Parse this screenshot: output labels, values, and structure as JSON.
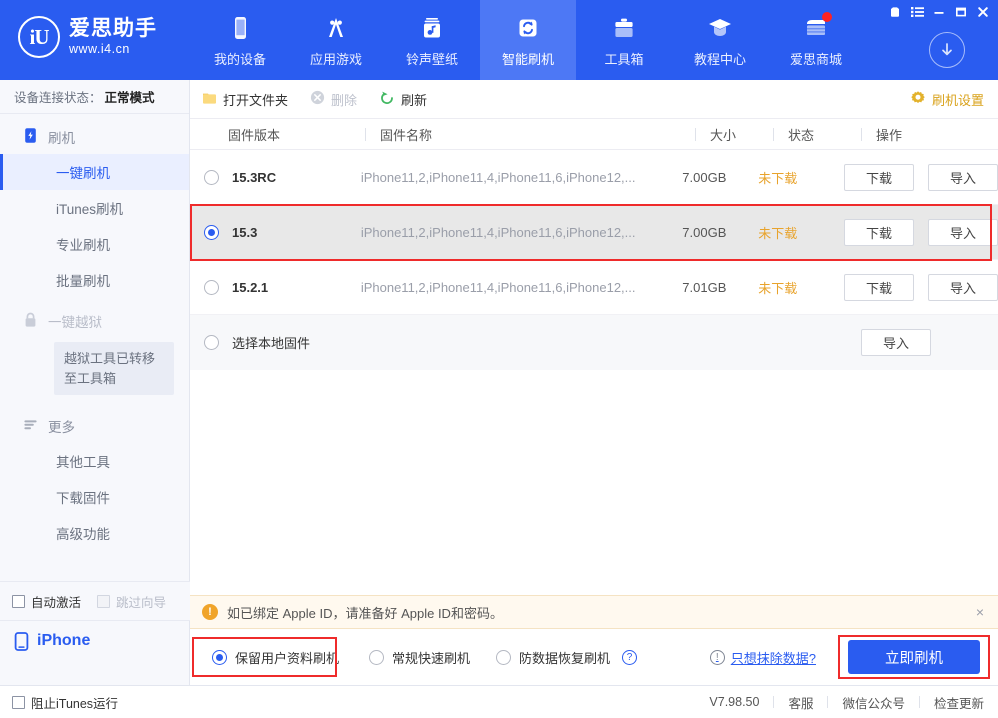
{
  "brand": {
    "name": "爱思助手",
    "url": "www.i4.cn",
    "logo_text": "iU"
  },
  "topnav": {
    "items": [
      {
        "label": "我的设备",
        "icon": "phone-icon",
        "active": false
      },
      {
        "label": "应用游戏",
        "icon": "appstore-icon",
        "active": false
      },
      {
        "label": "铃声壁纸",
        "icon": "music-icon",
        "active": false
      },
      {
        "label": "智能刷机",
        "icon": "refresh-icon",
        "active": true
      },
      {
        "label": "工具箱",
        "icon": "toolbox-icon",
        "active": false
      },
      {
        "label": "教程中心",
        "icon": "graduation-cap-icon",
        "active": false
      },
      {
        "label": "爱思商城",
        "icon": "store-icon",
        "active": false,
        "badge": true
      }
    ],
    "window_buttons": [
      "skin-icon",
      "menu-icon",
      "minimize-icon",
      "maximize-icon",
      "close-icon"
    ],
    "download_button": "download-arrow-icon",
    "accent_color": "#2a5cf0",
    "active_color": "#4d78f5"
  },
  "sidebar": {
    "device_status_label": "设备连接状态：",
    "device_status_value": "正常模式",
    "groups": [
      {
        "head": "刷机",
        "head_icon": "flash-device-icon",
        "items": [
          {
            "label": "一键刷机",
            "active": true
          },
          {
            "label": "iTunes刷机",
            "active": false
          },
          {
            "label": "专业刷机",
            "active": false
          },
          {
            "label": "批量刷机",
            "active": false
          }
        ]
      },
      {
        "head": "一键越狱",
        "head_icon": "lock-icon",
        "disabled": true,
        "tooltip": "越狱工具已转移至工具箱",
        "items": []
      },
      {
        "head": "更多",
        "head_icon": "list-icon",
        "items": [
          {
            "label": "其他工具",
            "active": false
          },
          {
            "label": "下载固件",
            "active": false
          },
          {
            "label": "高级功能",
            "active": false
          }
        ]
      }
    ],
    "checkboxes": [
      {
        "label": "自动激活",
        "checked": false,
        "disabled": false
      },
      {
        "label": "跳过向导",
        "checked": false,
        "disabled": true
      }
    ],
    "device": {
      "name": "iPhone",
      "icon": "phone-icon"
    }
  },
  "main": {
    "toolbar": {
      "open_folder": "打开文件夹",
      "delete": "删除",
      "refresh": "刷新",
      "settings": "刷机设置"
    },
    "table": {
      "headers": [
        "固件版本",
        "固件名称",
        "大小",
        "状态",
        "操作"
      ],
      "rows": [
        {
          "version": "15.3RC",
          "name": "iPhone11,2,iPhone11,4,iPhone11,6,iPhone12,...",
          "size": "7.00GB",
          "status": "未下载",
          "selected": false,
          "actions": [
            "下载",
            "导入"
          ]
        },
        {
          "version": "15.3",
          "name": "iPhone11,2,iPhone11,4,iPhone11,6,iPhone12,...",
          "size": "7.00GB",
          "status": "未下载",
          "selected": true,
          "highlighted": true,
          "actions": [
            "下载",
            "导入"
          ]
        },
        {
          "version": "15.2.1",
          "name": "iPhone11,2,iPhone11,4,iPhone11,6,iPhone12,...",
          "size": "7.01GB",
          "status": "未下载",
          "selected": false,
          "actions": [
            "下载",
            "导入"
          ]
        }
      ],
      "local_row": {
        "label": "选择本地固件",
        "selected": false,
        "actions": [
          "导入"
        ]
      }
    },
    "notice": {
      "text": "如已绑定 Apple ID，请准备好 Apple ID和密码。",
      "icon": "warning-icon",
      "close": "×"
    },
    "action_bar": {
      "modes": [
        {
          "label": "保留用户资料刷机",
          "selected": true,
          "highlighted": true
        },
        {
          "label": "常规快速刷机",
          "selected": false
        },
        {
          "label": "防数据恢复刷机",
          "selected": false,
          "help": "?"
        }
      ],
      "erase_link": "只想抹除数据?",
      "erase_icon": "info-icon",
      "flash_button": "立即刷机",
      "flash_highlighted": true
    }
  },
  "statusbar": {
    "itunes_checkbox": {
      "label": "阻止iTunes运行",
      "checked": false
    },
    "version": "V7.98.50",
    "links": [
      "客服",
      "微信公众号",
      "检查更新"
    ]
  }
}
